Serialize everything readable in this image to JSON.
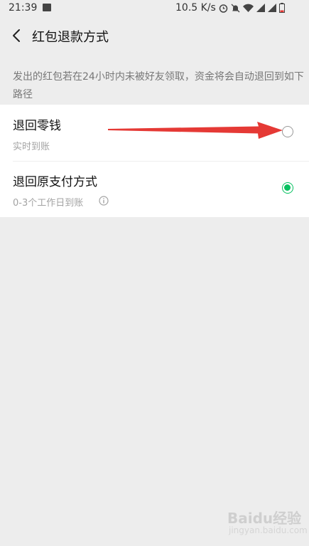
{
  "status_bar": {
    "time": "21:39",
    "network_speed": "10.5 K/s",
    "icons": [
      "image-icon",
      "alarm-icon",
      "mute-icon",
      "wifi-icon",
      "signal-icon",
      "signal-icon",
      "battery-icon"
    ]
  },
  "header": {
    "title": "红包退款方式",
    "back_icon": "chevron-left-icon"
  },
  "description": "发出的红包若在24小时内未被好友领取，资金将会自动退回到如下路径",
  "options": [
    {
      "label": "退回零钱",
      "sub": "实时到账",
      "selected": false
    },
    {
      "label": "退回原支付方式",
      "sub": "0-3个工作日到账",
      "selected": true,
      "info_icon": "info-icon"
    }
  ],
  "annotation": {
    "arrow_color": "#e53935",
    "icon": "red-arrow-icon"
  },
  "watermark": {
    "text": "Baidu经验",
    "sub": "jingyan.baidu.com"
  },
  "colors": {
    "accent": "#07c160",
    "background": "#ededed"
  }
}
